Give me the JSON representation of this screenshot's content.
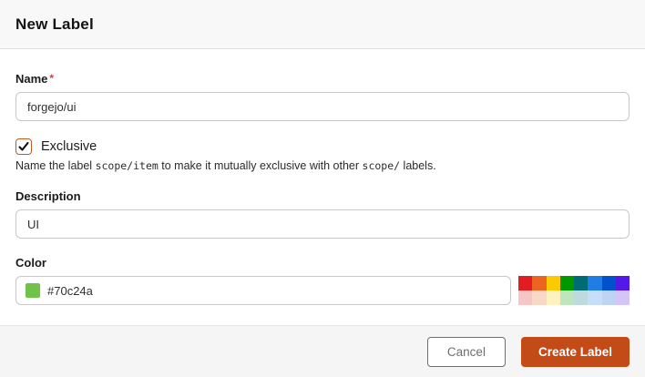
{
  "header": {
    "title": "New Label"
  },
  "form": {
    "name": {
      "label": "Name",
      "required_marker": "*",
      "value": "forgejo/ui"
    },
    "exclusive": {
      "label": "Exclusive",
      "checked": true,
      "check_glyph": "checkmark",
      "help_prefix": "Name the label ",
      "help_code1": "scope/item",
      "help_middle": " to make it mutually exclusive with other ",
      "help_code2": "scope/",
      "help_suffix": " labels."
    },
    "description": {
      "label": "Description",
      "value": "UI"
    },
    "color": {
      "label": "Color",
      "value": "#70c24a",
      "swatch_color": "#70c24a"
    }
  },
  "palette": {
    "row1": [
      "#e11d21",
      "#eb6420",
      "#fbca04",
      "#009800",
      "#006b75",
      "#207de5",
      "#0052cc",
      "#5319e7"
    ],
    "row2": [
      "#f6c6c7",
      "#fad8c7",
      "#fef2c0",
      "#bfe5bf",
      "#bfdadc",
      "#c7def8",
      "#bfd4f2",
      "#d4c5f9"
    ]
  },
  "footer": {
    "cancel_label": "Cancel",
    "create_label": "Create Label"
  },
  "colors": {
    "accent": "#c24b17",
    "checkbox_border": "#c05a23",
    "required_red": "#db3b3b",
    "header_bg": "#f8f8f8",
    "footer_bg": "#f5f5f5"
  }
}
